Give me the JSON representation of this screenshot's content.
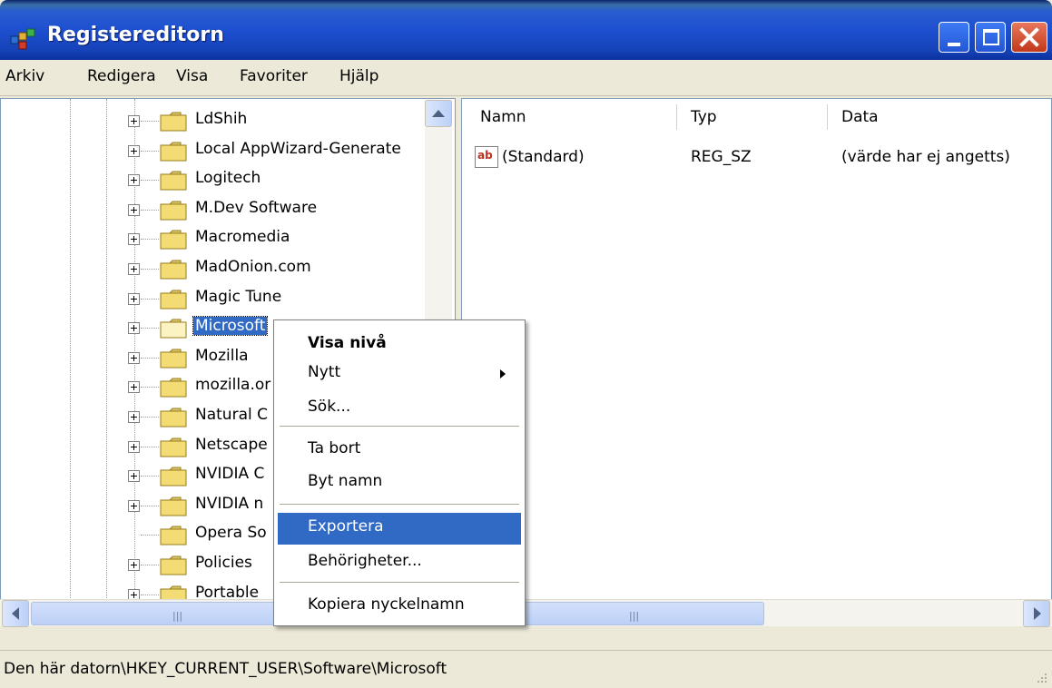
{
  "window": {
    "title": "Registereditorn",
    "app_icon": "registry-editor-icon"
  },
  "menu": {
    "items": [
      "Arkiv",
      "Redigera",
      "Visa",
      "Favoriter",
      "Hjälp"
    ]
  },
  "tree": {
    "items": [
      {
        "label": "LdShih",
        "expander": true
      },
      {
        "label": "Local AppWizard-Generate",
        "expander": true
      },
      {
        "label": "Logitech",
        "expander": true
      },
      {
        "label": "M.Dev Software",
        "expander": true
      },
      {
        "label": "Macromedia",
        "expander": true
      },
      {
        "label": "MadOnion.com",
        "expander": true
      },
      {
        "label": "Magic Tune",
        "expander": true
      },
      {
        "label": "Microsoft",
        "expander": true,
        "selected": true
      },
      {
        "label": "Mozilla",
        "expander": true
      },
      {
        "label": "mozilla.or",
        "expander": true
      },
      {
        "label": "Natural C",
        "expander": true
      },
      {
        "label": "Netscape",
        "expander": true
      },
      {
        "label": "NVIDIA C",
        "expander": true
      },
      {
        "label": "NVIDIA n",
        "expander": true
      },
      {
        "label": "Opera So",
        "expander": false
      },
      {
        "label": "Policies",
        "expander": true
      },
      {
        "label": "Portable",
        "expander": true
      }
    ]
  },
  "list": {
    "columns": [
      "Namn",
      "Typ",
      "Data"
    ],
    "rows": [
      {
        "name": "(Standard)",
        "type": "REG_SZ",
        "data": "(värde har ej angetts)"
      }
    ]
  },
  "context_menu": {
    "items": [
      "Visa nivå",
      "Nytt",
      "Sök...",
      "Ta bort",
      "Byt namn",
      "Exportera",
      "Behörigheter...",
      "Kopiera nyckelnamn"
    ],
    "highlighted": "Exportera"
  },
  "status": {
    "path": "Den här datorn\\HKEY_CURRENT_USER\\Software\\Microsoft"
  },
  "colors": {
    "selection": "#316ac5",
    "titlebar": "#1d4fd0",
    "close_button": "#c2381b"
  }
}
